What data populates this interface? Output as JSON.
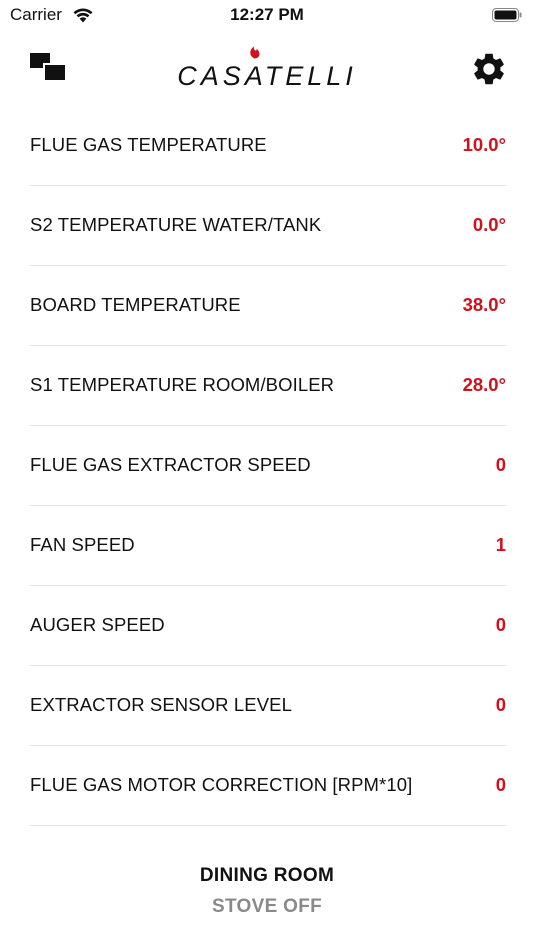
{
  "status_bar": {
    "carrier": "Carrier",
    "time": "12:27 PM"
  },
  "header": {
    "brand": "CASATELLI",
    "left_icon": "windows-icon",
    "right_icon": "gear-icon",
    "accent_color": "#d0111b"
  },
  "readings": [
    {
      "label": "FLUE GAS TEMPERATURE",
      "value": "10.0°"
    },
    {
      "label": "S2 TEMPERATURE WATER/TANK",
      "value": "0.0°"
    },
    {
      "label": "BOARD TEMPERATURE",
      "value": "38.0°"
    },
    {
      "label": "S1 TEMPERATURE ROOM/BOILER",
      "value": "28.0°"
    },
    {
      "label": "FLUE GAS EXTRACTOR SPEED",
      "value": "0"
    },
    {
      "label": "FAN SPEED",
      "value": "1"
    },
    {
      "label": "AUGER SPEED",
      "value": "0"
    },
    {
      "label": "EXTRACTOR SENSOR LEVEL",
      "value": "0"
    },
    {
      "label": "FLUE GAS MOTOR CORRECTION [RPM*10]",
      "value": "0"
    }
  ],
  "footer": {
    "room": "DINING ROOM",
    "status": "STOVE OFF"
  }
}
